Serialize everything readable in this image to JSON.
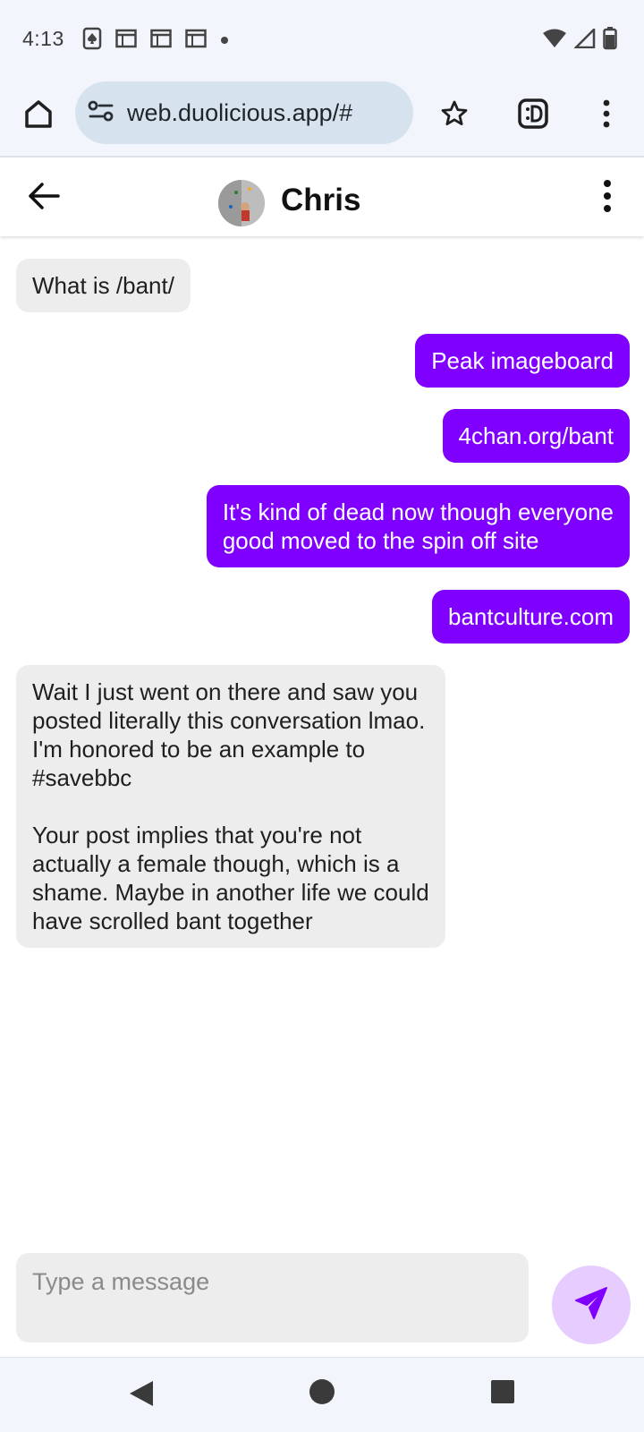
{
  "status_bar": {
    "time": "4:13",
    "left_icons": [
      "spade-card-notification-icon",
      "calendar-icon",
      "calendar-icon",
      "calendar-icon",
      "dot-icon"
    ],
    "right_icons": [
      "wifi-icon",
      "signal-icon",
      "battery-icon"
    ]
  },
  "browser": {
    "url": "web.duolicious.app/#",
    "icons": [
      "home-icon",
      "site-settings-icon",
      "star-icon",
      "duolicious-app-icon",
      "more-vert-icon"
    ]
  },
  "chat": {
    "name": "Chris",
    "icons": [
      "arrow-back-icon",
      "avatar-photo",
      "more-vert-icon"
    ]
  },
  "messages": [
    {
      "direction": "incoming",
      "text": "What is /bant/"
    },
    {
      "direction": "outgoing",
      "text": "Peak imageboard"
    },
    {
      "direction": "outgoing",
      "text": "4chan.org/bant"
    },
    {
      "direction": "outgoing",
      "text": "It's kind of dead now though everyone\ngood moved to the spin off site"
    },
    {
      "direction": "outgoing",
      "text": "bantculture.com"
    },
    {
      "direction": "incoming",
      "text": "Wait I just went on there and saw you\nposted literally this conversation lmao.\nI'm honored to be an example to\n#savebbc\n\nYour post implies that you're not\nactually a female though, which is a\nshame. Maybe in another life we could\nhave scrolled bant together"
    }
  ],
  "composer": {
    "placeholder": "Type a message",
    "value": "",
    "send_icon": "send-icon"
  },
  "nav_bar": {
    "icons": [
      "nav-back-icon",
      "nav-home-icon",
      "nav-recents-icon"
    ]
  },
  "colors": {
    "outgoing_bubble": "#7f00ff",
    "incoming_bubble": "#ededed",
    "send_button_bg": "#e6ccff",
    "send_icon": "#7f00ff",
    "url_pill": "#d6e3ef",
    "system_bars": "#f2f5fb"
  }
}
